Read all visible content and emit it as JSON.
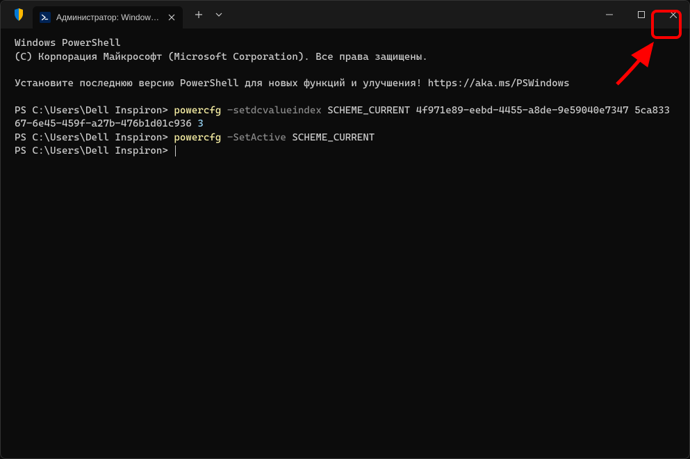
{
  "tab": {
    "title": "Администратор: Windows Po"
  },
  "terminal": {
    "header1": "Windows PowerShell",
    "header2": "(C) Корпорация Майкрософт (Microsoft Corporation). Все права защищены.",
    "notice": "Установите последнюю версию PowerShell для новых функций и улучшения! https://aka.ms/PSWindows",
    "prompt": "PS C:\\Users\\Dell Inspiron> ",
    "cmd1_name": "powercfg",
    "cmd1_flag": " -setdcvalueindex",
    "cmd1_args": " SCHEME_CURRENT 4f971e89-eebd-4455-a8de-9e59040e7347 5ca83367-6e45-459f-a27b-476b1d01c936 ",
    "cmd1_value": "3",
    "cmd2_name": "powercfg",
    "cmd2_flag": " -SetActive",
    "cmd2_args": " SCHEME_CURRENT"
  }
}
